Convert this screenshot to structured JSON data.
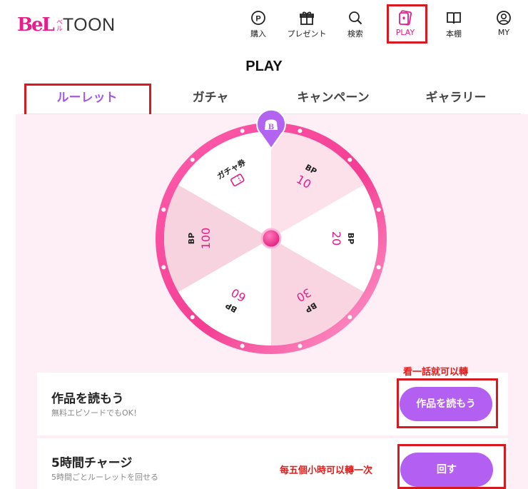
{
  "header": {
    "logo": {
      "main": "BeL",
      "small": "ベル",
      "toon": "TOON"
    },
    "nav": [
      {
        "label": "購入",
        "icon": "point-coin-icon"
      },
      {
        "label": "プレゼント",
        "icon": "gift-icon"
      },
      {
        "label": "検索",
        "icon": "search-icon"
      },
      {
        "label": "PLAY",
        "icon": "play-cards-icon"
      },
      {
        "label": "本棚",
        "icon": "book-icon"
      },
      {
        "label": "MY",
        "icon": "user-icon"
      }
    ]
  },
  "page_title": "PLAY",
  "tabs": [
    "ルーレット",
    "ガチャ",
    "キャンペーン",
    "ギャラリー"
  ],
  "roulette": {
    "pointer_letter": "B",
    "segments": [
      {
        "label": "BP",
        "value": "10"
      },
      {
        "label": "BP",
        "value": "20"
      },
      {
        "label": "BP",
        "value": "30"
      },
      {
        "label": "BP",
        "value": "60"
      },
      {
        "label": "BP",
        "value": "100"
      },
      {
        "label": "ガチャ券",
        "value": ""
      }
    ]
  },
  "cards": [
    {
      "title": "作品を読もう",
      "subtitle": "無料エピソードでもOK！",
      "button": "作品を読もう",
      "note": "看一話就可以轉"
    },
    {
      "title": "5時間チャージ",
      "subtitle": "5時間ごとルーレットを回せる",
      "button": "回す",
      "note": "每五個小時可以轉一次"
    }
  ],
  "colors": {
    "accent_pink": "#e61e8c",
    "accent_purple": "#b25ff2",
    "highlight_red": "#d8191f",
    "wheel_pink": "#f7d3df"
  }
}
